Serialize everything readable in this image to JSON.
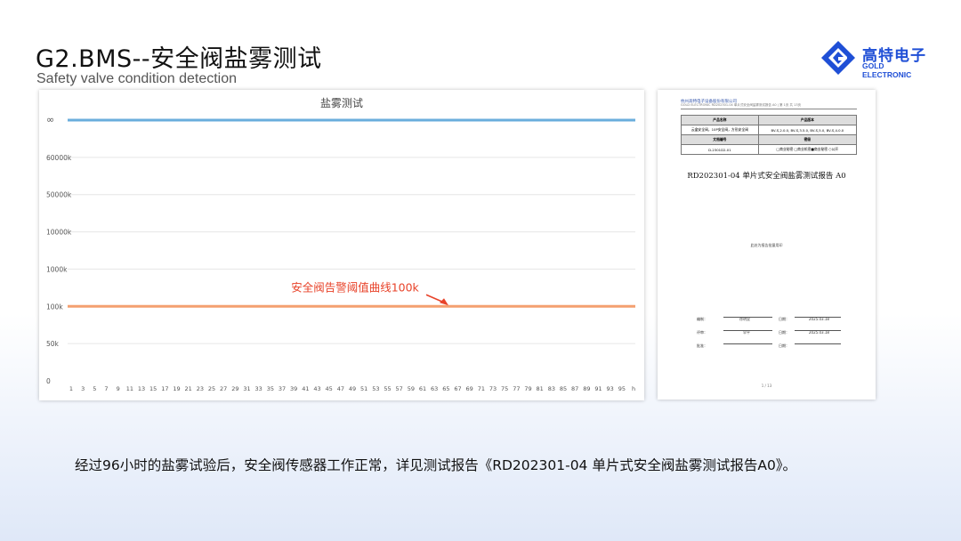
{
  "header": {
    "title": "G2.BMS--安全阀盐雾测试",
    "subtitle": "Safety valve condition detection"
  },
  "logo": {
    "icon": "gold-electronic-g-icon",
    "name_cn": "高特电子",
    "name_en": "GOLD ELECTRONIC",
    "color": "#1f4fd6"
  },
  "chart_data": {
    "type": "line",
    "title": "盐雾测试",
    "x_ticks": [
      "1",
      "3",
      "5",
      "7",
      "9",
      "11",
      "13",
      "15",
      "17",
      "19",
      "21",
      "23",
      "25",
      "27",
      "29",
      "31",
      "33",
      "35",
      "37",
      "39",
      "41",
      "43",
      "45",
      "47",
      "49",
      "51",
      "53",
      "55",
      "57",
      "59",
      "61",
      "63",
      "65",
      "67",
      "69",
      "71",
      "73",
      "75",
      "77",
      "79",
      "81",
      "83",
      "85",
      "87",
      "89",
      "91",
      "93",
      "95",
      "h"
    ],
    "y_ticks": [
      "0",
      "50k",
      "100k",
      "1000k",
      "10000k",
      "50000k",
      "60000k",
      "∞"
    ],
    "series": [
      {
        "values": [
          "∞"
        ],
        "color": "#6aaedc",
        "level": "∞"
      },
      {
        "values": [
          "100k"
        ],
        "color": "#f4a070",
        "level": "100k"
      }
    ],
    "annotation": "安全阀告警阈值曲线100k",
    "annotation_color": "#e8432a",
    "grid": "horizontal"
  },
  "report": {
    "company": "杭州高特电子设备股份有限公司",
    "company_sub": "GOLD ELECTRONIC  RD202301-04 单片式安全阀盐雾测试报告 A0 | 第 1页 共 13页",
    "table": [
      [
        "产品名称",
        "产品版本"
      ],
      [
        "云盒安全阀，10P安全阀，方形安全阀",
        "BV-S,2.0.0, BV-S,3.5.0, BV-S,5.0, BV-S,4.0.0"
      ],
      [
        "文档编号",
        "密级"
      ],
      [
        "D-2301D2-01",
        "□商业秘密  □商业机密■商业秘密  ○公开"
      ]
    ],
    "title": "RD202301-04 单片式安全阀盐雾测试报告 A0",
    "note": "此处为报告批量用印",
    "sign": [
      {
        "label": "编制：",
        "name": "徐明显",
        "date_label": "日期：",
        "date": "2025.03.18"
      },
      {
        "label": "评审：",
        "name": "罕平",
        "date_label": "日期：",
        "date": "2025.03.18"
      },
      {
        "label": "批准：",
        "name": "",
        "date_label": "日期：",
        "date": ""
      }
    ],
    "footer": "1 / 13"
  },
  "caption": "经过96小时的盐雾试验后，安全阀传感器工作正常，详见测试报告《RD202301-04 单片式安全阀盐雾测试报告A0》。"
}
